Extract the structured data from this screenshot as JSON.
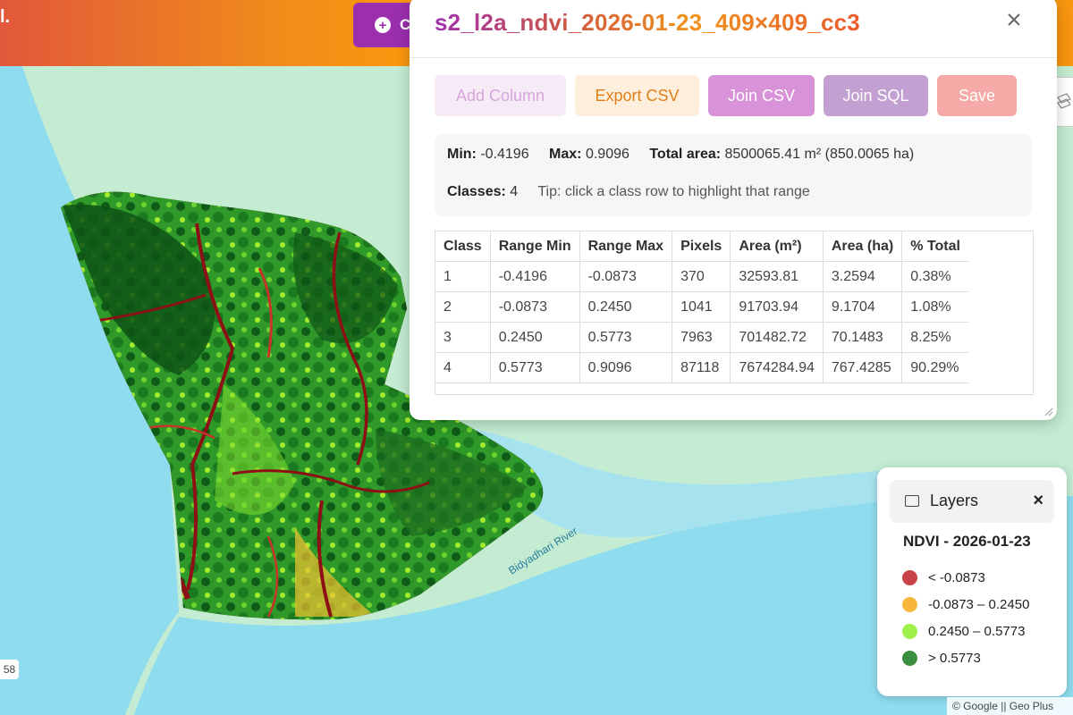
{
  "topbar": {
    "brand_fragment": "l.",
    "primary_button_label": "C"
  },
  "map": {
    "river_label": "Bidyadhari River",
    "zoom_badge": "58",
    "attribution": "© Google || Geo Plus",
    "colors": {
      "land": "#c3ecd3",
      "water": "#8fdcef",
      "raster_border": "#7a0d12"
    }
  },
  "popup": {
    "title": "s2_l2a_ndvi_2026-01-23_409×409_cc3",
    "close_icon": "close-icon",
    "actions": {
      "add_column": "Add Column",
      "export_csv": "Export CSV",
      "join_csv": "Join CSV",
      "join_sql": "Join SQL",
      "save": "Save"
    },
    "summary": {
      "min_label": "Min:",
      "min_value": "-0.4196",
      "max_label": "Max:",
      "max_value": "0.9096",
      "area_label": "Total area:",
      "area_value": "8500065.41 m² (850.0065 ha)",
      "classes_label": "Classes:",
      "classes_value": "4",
      "tip": "Tip: click a class row to highlight that range"
    },
    "table": {
      "headers": [
        "Class",
        "Range Min",
        "Range Max",
        "Pixels",
        "Area (m²)",
        "Area (ha)",
        "% Total"
      ],
      "rows": [
        [
          "1",
          "-0.4196",
          "-0.0873",
          "370",
          "32593.81",
          "3.2594",
          "0.38%"
        ],
        [
          "2",
          "-0.0873",
          "0.2450",
          "1041",
          "91703.94",
          "9.1704",
          "1.08%"
        ],
        [
          "3",
          "0.2450",
          "0.5773",
          "7963",
          "701482.72",
          "70.1483",
          "8.25%"
        ],
        [
          "4",
          "0.5773",
          "0.9096",
          "87118",
          "7674284.94",
          "767.4285",
          "90.29%"
        ]
      ]
    }
  },
  "layers": {
    "title": "Layers",
    "close_label": "×",
    "layer_name": "NDVI - 2026-01-23",
    "legend": [
      {
        "label": "< -0.0873",
        "color": "#c8434a"
      },
      {
        "label": "-0.0873 – 0.2450",
        "color": "#f6b73c"
      },
      {
        "label": "0.2450 – 0.5773",
        "color": "#9ef04a"
      },
      {
        "label": "> 0.5773",
        "color": "#3a8f3f"
      }
    ]
  }
}
